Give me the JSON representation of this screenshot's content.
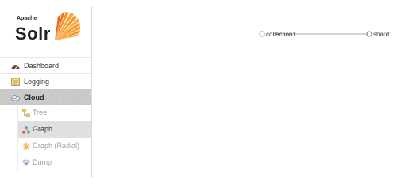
{
  "logo": {
    "top": "Apache",
    "name": "Solr"
  },
  "nav": {
    "items": [
      {
        "label": "Dashboard",
        "icon": "dashboard-icon"
      },
      {
        "label": "Logging",
        "icon": "logging-icon"
      },
      {
        "label": "Cloud",
        "icon": "cloud-icon",
        "active": true
      }
    ],
    "cloud_sub_items": [
      {
        "label": "Tree",
        "icon": "tree-icon"
      },
      {
        "label": "Graph",
        "icon": "graph-icon",
        "active": true
      },
      {
        "label": "Graph (Radial)",
        "icon": "radial-graph-icon"
      },
      {
        "label": "Dump",
        "icon": "dump-icon"
      }
    ]
  },
  "graph": {
    "nodes": [
      {
        "label": "collection1"
      },
      {
        "label": "shard1"
      }
    ]
  },
  "colors": {
    "sidebar_active_bg": "#cccccc",
    "sub_active_bg": "#e0e0e0",
    "edge": "#aaaaaa",
    "logo_orange": "#f7941e"
  }
}
